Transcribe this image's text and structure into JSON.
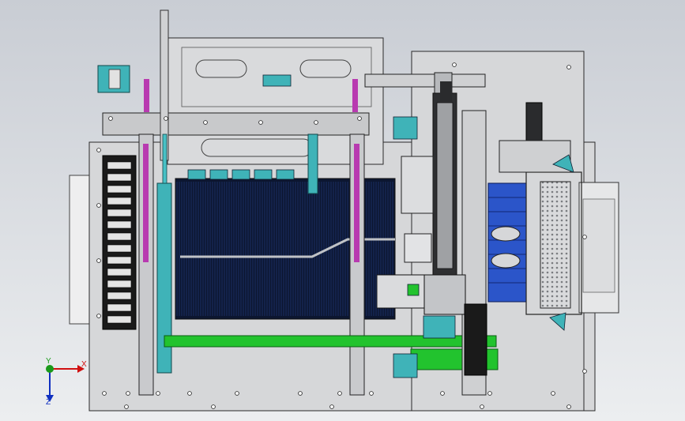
{
  "viewport": {
    "background_top": "#c9cdd4",
    "background_bottom": "#ecedef",
    "frame_color": "#d6d7d9",
    "steel_color": "#c4c6c8",
    "edge_color": "#2a2a2a",
    "pneumatic_color": "#3fb3b8",
    "conveyor_color": "#22c32e",
    "magenta_color": "#b83ab0",
    "blue_part_color": "#2b55c9",
    "comb_color": "#0c1630"
  },
  "triad": {
    "x_label": "X",
    "y_label": "Y",
    "z_label": "Z",
    "x_color": "#d01010",
    "y_color": "#1a9a1a",
    "z_color": "#1030c0"
  }
}
